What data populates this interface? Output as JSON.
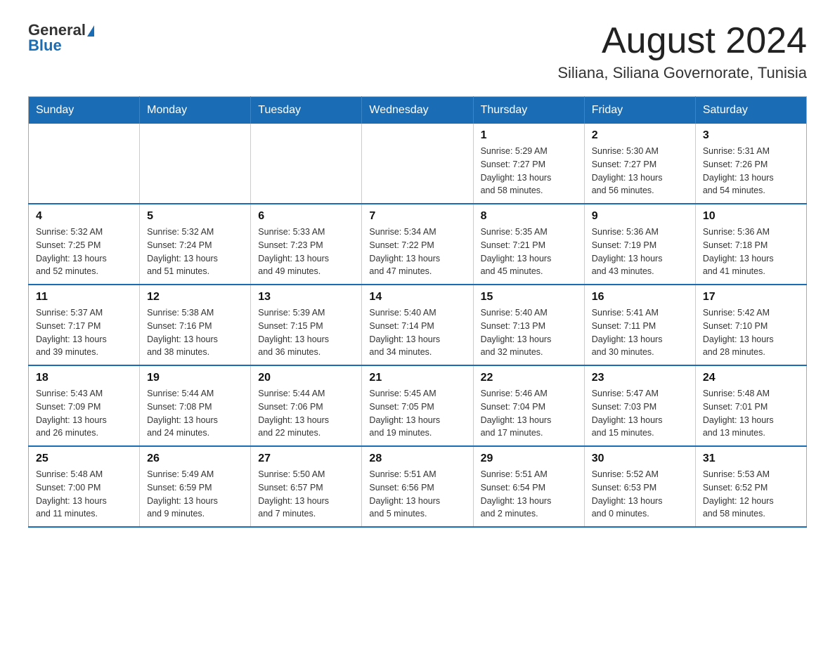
{
  "header": {
    "logo": {
      "text_general": "General",
      "text_blue": "Blue"
    },
    "month_title": "August 2024",
    "location": "Siliana, Siliana Governorate, Tunisia"
  },
  "days_of_week": [
    "Sunday",
    "Monday",
    "Tuesday",
    "Wednesday",
    "Thursday",
    "Friday",
    "Saturday"
  ],
  "weeks": [
    {
      "cells": [
        {
          "day": "",
          "info": ""
        },
        {
          "day": "",
          "info": ""
        },
        {
          "day": "",
          "info": ""
        },
        {
          "day": "",
          "info": ""
        },
        {
          "day": "1",
          "info": "Sunrise: 5:29 AM\nSunset: 7:27 PM\nDaylight: 13 hours\nand 58 minutes."
        },
        {
          "day": "2",
          "info": "Sunrise: 5:30 AM\nSunset: 7:27 PM\nDaylight: 13 hours\nand 56 minutes."
        },
        {
          "day": "3",
          "info": "Sunrise: 5:31 AM\nSunset: 7:26 PM\nDaylight: 13 hours\nand 54 minutes."
        }
      ]
    },
    {
      "cells": [
        {
          "day": "4",
          "info": "Sunrise: 5:32 AM\nSunset: 7:25 PM\nDaylight: 13 hours\nand 52 minutes."
        },
        {
          "day": "5",
          "info": "Sunrise: 5:32 AM\nSunset: 7:24 PM\nDaylight: 13 hours\nand 51 minutes."
        },
        {
          "day": "6",
          "info": "Sunrise: 5:33 AM\nSunset: 7:23 PM\nDaylight: 13 hours\nand 49 minutes."
        },
        {
          "day": "7",
          "info": "Sunrise: 5:34 AM\nSunset: 7:22 PM\nDaylight: 13 hours\nand 47 minutes."
        },
        {
          "day": "8",
          "info": "Sunrise: 5:35 AM\nSunset: 7:21 PM\nDaylight: 13 hours\nand 45 minutes."
        },
        {
          "day": "9",
          "info": "Sunrise: 5:36 AM\nSunset: 7:19 PM\nDaylight: 13 hours\nand 43 minutes."
        },
        {
          "day": "10",
          "info": "Sunrise: 5:36 AM\nSunset: 7:18 PM\nDaylight: 13 hours\nand 41 minutes."
        }
      ]
    },
    {
      "cells": [
        {
          "day": "11",
          "info": "Sunrise: 5:37 AM\nSunset: 7:17 PM\nDaylight: 13 hours\nand 39 minutes."
        },
        {
          "day": "12",
          "info": "Sunrise: 5:38 AM\nSunset: 7:16 PM\nDaylight: 13 hours\nand 38 minutes."
        },
        {
          "day": "13",
          "info": "Sunrise: 5:39 AM\nSunset: 7:15 PM\nDaylight: 13 hours\nand 36 minutes."
        },
        {
          "day": "14",
          "info": "Sunrise: 5:40 AM\nSunset: 7:14 PM\nDaylight: 13 hours\nand 34 minutes."
        },
        {
          "day": "15",
          "info": "Sunrise: 5:40 AM\nSunset: 7:13 PM\nDaylight: 13 hours\nand 32 minutes."
        },
        {
          "day": "16",
          "info": "Sunrise: 5:41 AM\nSunset: 7:11 PM\nDaylight: 13 hours\nand 30 minutes."
        },
        {
          "day": "17",
          "info": "Sunrise: 5:42 AM\nSunset: 7:10 PM\nDaylight: 13 hours\nand 28 minutes."
        }
      ]
    },
    {
      "cells": [
        {
          "day": "18",
          "info": "Sunrise: 5:43 AM\nSunset: 7:09 PM\nDaylight: 13 hours\nand 26 minutes."
        },
        {
          "day": "19",
          "info": "Sunrise: 5:44 AM\nSunset: 7:08 PM\nDaylight: 13 hours\nand 24 minutes."
        },
        {
          "day": "20",
          "info": "Sunrise: 5:44 AM\nSunset: 7:06 PM\nDaylight: 13 hours\nand 22 minutes."
        },
        {
          "day": "21",
          "info": "Sunrise: 5:45 AM\nSunset: 7:05 PM\nDaylight: 13 hours\nand 19 minutes."
        },
        {
          "day": "22",
          "info": "Sunrise: 5:46 AM\nSunset: 7:04 PM\nDaylight: 13 hours\nand 17 minutes."
        },
        {
          "day": "23",
          "info": "Sunrise: 5:47 AM\nSunset: 7:03 PM\nDaylight: 13 hours\nand 15 minutes."
        },
        {
          "day": "24",
          "info": "Sunrise: 5:48 AM\nSunset: 7:01 PM\nDaylight: 13 hours\nand 13 minutes."
        }
      ]
    },
    {
      "cells": [
        {
          "day": "25",
          "info": "Sunrise: 5:48 AM\nSunset: 7:00 PM\nDaylight: 13 hours\nand 11 minutes."
        },
        {
          "day": "26",
          "info": "Sunrise: 5:49 AM\nSunset: 6:59 PM\nDaylight: 13 hours\nand 9 minutes."
        },
        {
          "day": "27",
          "info": "Sunrise: 5:50 AM\nSunset: 6:57 PM\nDaylight: 13 hours\nand 7 minutes."
        },
        {
          "day": "28",
          "info": "Sunrise: 5:51 AM\nSunset: 6:56 PM\nDaylight: 13 hours\nand 5 minutes."
        },
        {
          "day": "29",
          "info": "Sunrise: 5:51 AM\nSunset: 6:54 PM\nDaylight: 13 hours\nand 2 minutes."
        },
        {
          "day": "30",
          "info": "Sunrise: 5:52 AM\nSunset: 6:53 PM\nDaylight: 13 hours\nand 0 minutes."
        },
        {
          "day": "31",
          "info": "Sunrise: 5:53 AM\nSunset: 6:52 PM\nDaylight: 12 hours\nand 58 minutes."
        }
      ]
    }
  ]
}
